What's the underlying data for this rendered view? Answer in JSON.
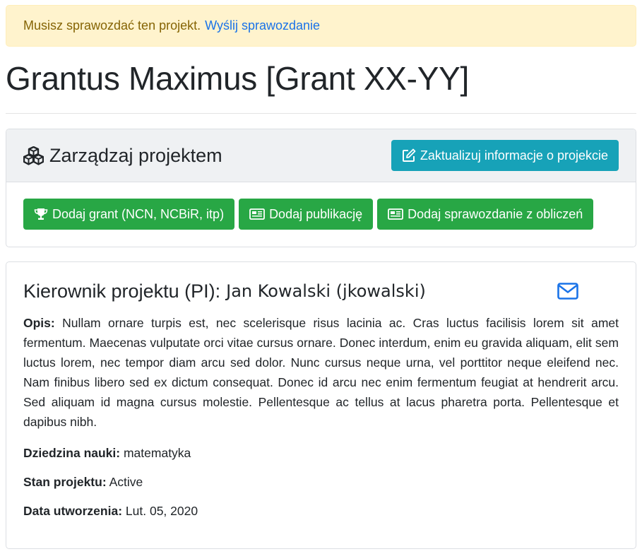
{
  "alert": {
    "text": "Musisz sprawozdać ten projekt.",
    "link": "Wyślij sprawozdanie"
  },
  "project": {
    "title": "Grantus Maximus [Grant XX-YY]"
  },
  "manage": {
    "title": "Zarządzaj projektem",
    "title_icon": "cubes-icon",
    "update_label": "Zaktualizuj informacje o projekcie",
    "update_icon": "edit-icon",
    "actions": [
      {
        "label": "Dodaj grant (NCN, NCBiR, itp)",
        "icon": "trophy-icon"
      },
      {
        "label": "Dodaj publikację",
        "icon": "newspaper-icon"
      },
      {
        "label": "Dodaj sprawozdanie z obliczeń",
        "icon": "newspaper-icon"
      }
    ]
  },
  "details": {
    "pi_label": "Kierownik projektu (PI):",
    "pi_name": "Jan Kowalski (jkowalski)",
    "mail_icon": "envelope-icon",
    "description_label": "Opis:",
    "description": "Nullam ornare turpis est, nec scelerisque risus lacinia ac. Cras luctus facilisis lorem sit amet fermentum. Maecenas vulputate orci vitae cursus ornare. Donec interdum, enim eu gravida aliquam, elit sem luctus lorem, nec tempor diam arcu sed dolor. Nunc cursus neque urna, vel porttitor neque eleifend nec. Nam finibus libero sed ex dictum consequat. Donec id arcu nec enim fermentum feugiat at hendrerit arcu. Sed aliquam id magna cursus molestie. Pellentesque ac tellus at lacus pharetra porta. Pellentesque et dapibus nibh.",
    "field_label": "Dziedzina nauki:",
    "field_value": "matematyka",
    "state_label": "Stan projektu:",
    "state_value": "Active",
    "created_label": "Data utworzenia:",
    "created_value": "Lut. 05, 2020"
  },
  "colors": {
    "info": "#17a2b8",
    "success": "#28a745",
    "alert_bg": "#fff3cd",
    "alert_text": "#856404",
    "link": "#1a73e8"
  }
}
